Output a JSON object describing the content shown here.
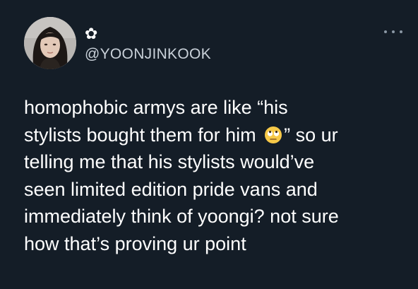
{
  "author": {
    "display_name": "✿",
    "handle": "@YOONJINKOOK",
    "avatar_icon": "profile-photo"
  },
  "tweet": {
    "line1": "homophobic armys are like “his",
    "line2_before": "stylists bought them for him",
    "line2_after": "” so ur",
    "line3": "telling me that his stylists would’ve",
    "line4": "seen limited edition pride vans and",
    "line5": "immediately think of yoongi? not sure",
    "line6": "how that’s proving ur point",
    "emoji": "face-with-rolling-eyes"
  },
  "menu": {
    "more_icon": "ellipsis-icon"
  },
  "colors": {
    "background": "#141d27",
    "text": "#ffffff",
    "handle": "#c9d1d9",
    "icon": "#8b98a5"
  }
}
